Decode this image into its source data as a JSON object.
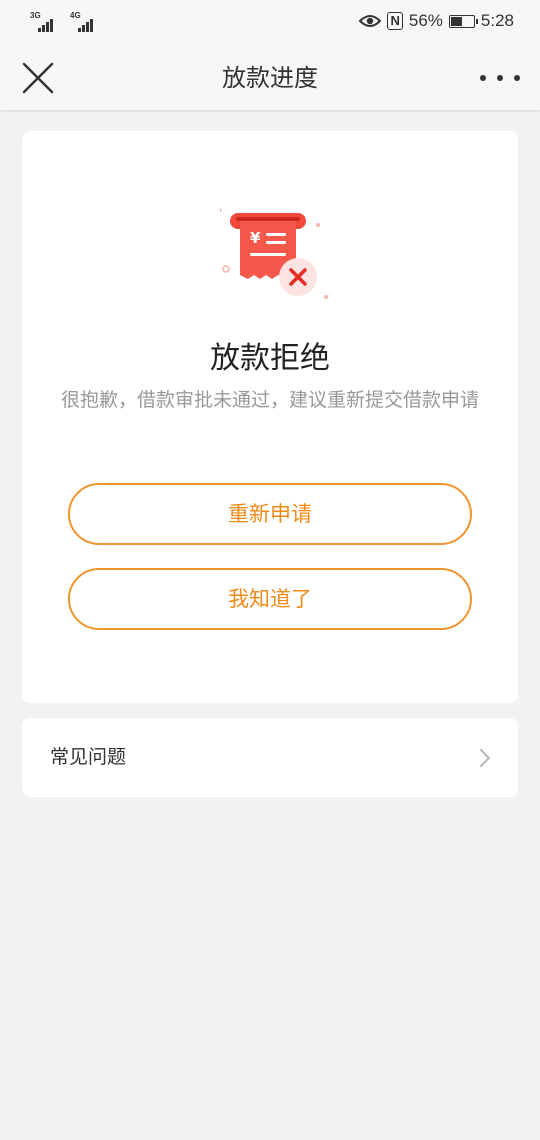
{
  "status_bar": {
    "network_1": "3G",
    "network_2": "4G",
    "battery_percent": "56%",
    "battery_level": 0.56,
    "time": "5:28"
  },
  "nav": {
    "title": "放款进度"
  },
  "result": {
    "title": "放款拒绝",
    "description": "很抱歉，借款审批未通过，建议重新提交借款申请",
    "receipt_symbol": "¥"
  },
  "buttons": {
    "reapply_label": "重新申请",
    "ack_label": "我知道了"
  },
  "faq": {
    "label": "常见问题"
  },
  "colors": {
    "accent": "#f08a16",
    "button_border": "#f0952b",
    "error_red": "#f4483c",
    "background": "#f2f2f2"
  }
}
